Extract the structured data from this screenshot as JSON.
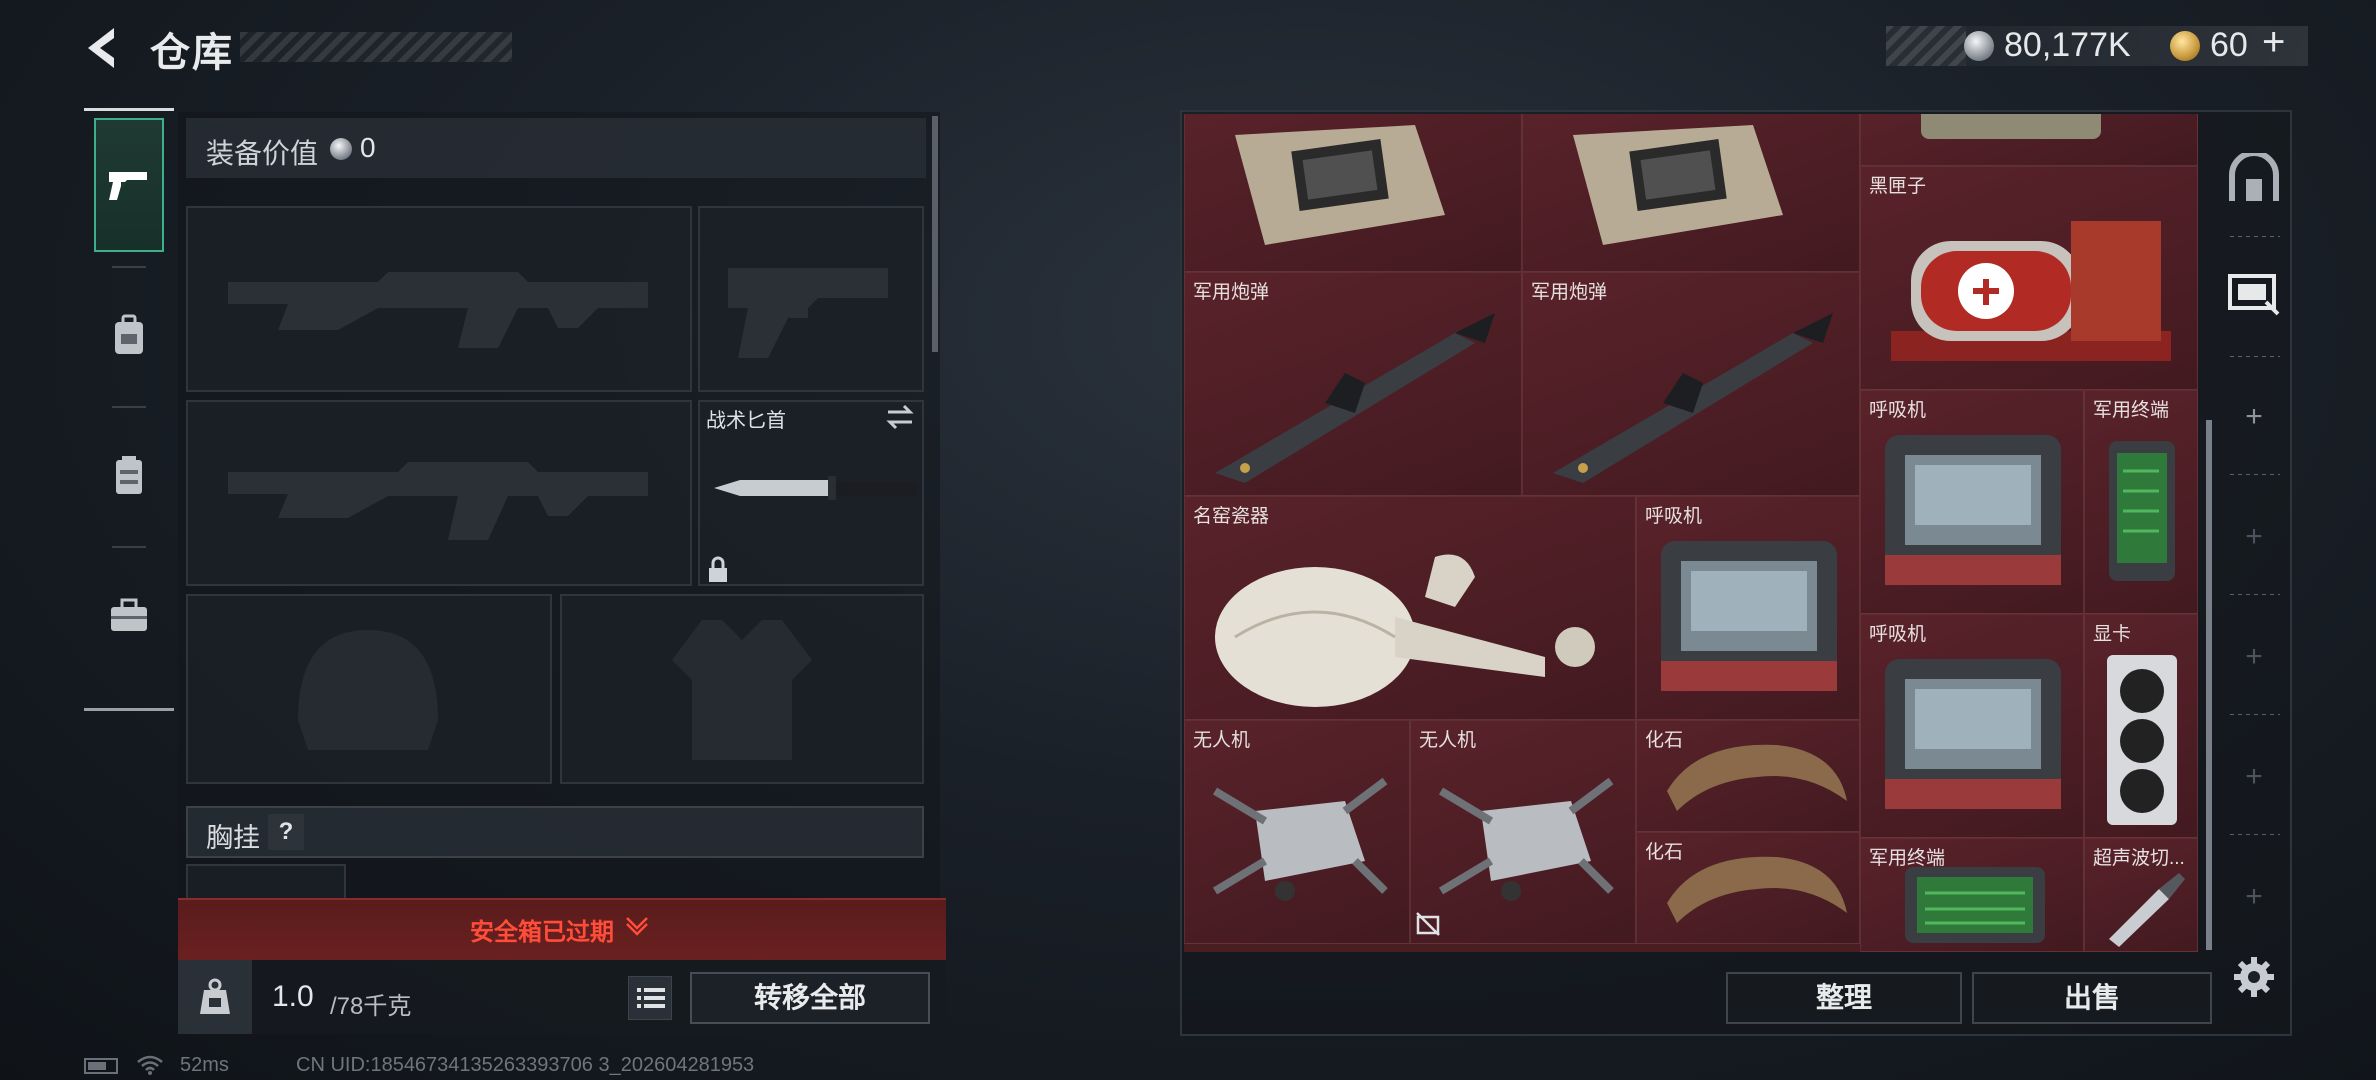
{
  "header": {
    "title": "仓库",
    "silver_amount": "80,177K",
    "gold_amount": "60",
    "plus": "+"
  },
  "sidebar": {
    "tabs": [
      {
        "icon": "pistol-icon",
        "active": true
      },
      {
        "icon": "backpack-icon",
        "active": false
      },
      {
        "icon": "vest-icon",
        "active": false
      },
      {
        "icon": "briefcase-icon",
        "active": false
      }
    ]
  },
  "equipment": {
    "value_label": "装备价值",
    "value": "0",
    "knife_label": "战术匕首",
    "chest_label": "胸挂",
    "help": "?",
    "safe_box_expired": "安全箱已过期",
    "weight_current": "1.0",
    "weight_max": "/78千克",
    "transfer_all": "转移全部"
  },
  "status": {
    "ping": "52ms",
    "uid": "CN UID:18546734135263393706 3_202604281953"
  },
  "grid": {
    "items": [
      {
        "label": "",
        "type": "circuit"
      },
      {
        "label": "",
        "type": "circuit"
      },
      {
        "label": "",
        "type": "case"
      },
      {
        "label": "黑匣子",
        "type": "blackbox"
      },
      {
        "label": "军用炮弹",
        "type": "missile"
      },
      {
        "label": "军用炮弹",
        "type": "missile"
      },
      {
        "label": "呼吸机",
        "type": "ventilator"
      },
      {
        "label": "军用终端",
        "type": "terminal"
      },
      {
        "label": "名窑瓷器",
        "type": "vase"
      },
      {
        "label": "呼吸机",
        "type": "ventilator"
      },
      {
        "label": "呼吸机",
        "type": "ventilator"
      },
      {
        "label": "显卡",
        "type": "gpu"
      },
      {
        "label": "无人机",
        "type": "drone"
      },
      {
        "label": "无人机",
        "type": "drone"
      },
      {
        "label": "化石",
        "type": "fossil"
      },
      {
        "label": "化石",
        "type": "fossil"
      },
      {
        "label": "军用终端",
        "type": "terminal"
      },
      {
        "label": "超声波切...",
        "type": "cutter"
      }
    ],
    "sort": "整理",
    "sell": "出售"
  },
  "colors": {
    "accent_green": "#3fae8a",
    "grid_red": "#4a1d22",
    "warning_red": "#ff4d3a"
  }
}
